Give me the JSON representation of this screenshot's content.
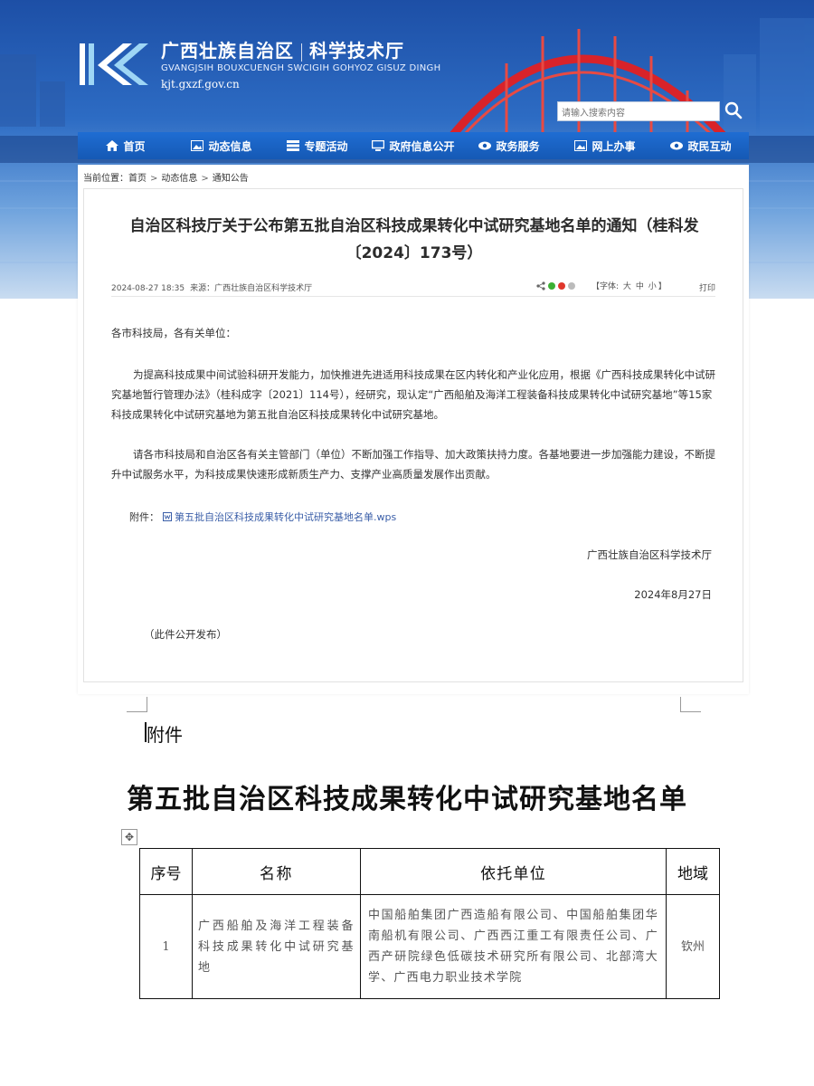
{
  "site": {
    "name_cn_left": "广西壮族自治区",
    "name_cn_right": "科学技术厅",
    "name_pinyin": "GVANGJSIH BOUXCUENGH SWCIGIH GOHYOZ GISUZ DINGH",
    "url": "kjt.gxzf.gov.cn"
  },
  "search": {
    "placeholder": "请输入搜索内容"
  },
  "nav": [
    "首页",
    "动态信息",
    "专题活动",
    "政府信息公开",
    "政务服务",
    "网上办事",
    "政民互动"
  ],
  "breadcrumb": {
    "prefix": "当前位置：",
    "items": [
      "首页",
      "动态信息",
      "通知公告"
    ]
  },
  "article": {
    "title": "自治区科技厅关于公布第五批自治区科技成果转化中试研究基地名单的通知（桂科发〔2024〕173号）",
    "datetime": "2024-08-27 18:35",
    "source": "来源：广西壮族自治区科学技术厅",
    "font_label": "【字体:",
    "font_sizes": [
      "大",
      "中",
      "小"
    ],
    "font_label_end": "】",
    "print": "打印",
    "salutation": "各市科技局，各有关单位：",
    "para1": "为提高科技成果中间试验科研开发能力，加快推进先进适用科技成果在区内转化和产业化应用，根据《广西科技成果转化中试研究基地暂行管理办法》（桂科成字〔2021〕114号），经研究，现认定“广西船舶及海洋工程装备科技成果转化中试研究基地”等15家科技成果转化中试研究基地为第五批自治区科技成果转化中试研究基地。",
    "para2": "请各市科技局和自治区各有关主管部门（单位）不断加强工作指导、加大政策扶持力度。各基地要进一步加强能力建设，不断提升中试服务水平，为科技成果快速形成新质生产力、支撑产业高质量发展作出贡献。",
    "attachment_label": "附件：",
    "attachment_file": "第五批自治区科技成果转化中试研究基地名单.wps",
    "signature": "广西壮族自治区科学技术厅",
    "date": "2024年8月27日",
    "publish_note": "（此件公开发布）"
  },
  "document": {
    "attachment_heading": "附件",
    "title": "第五批自治区科技成果转化中试研究基地名单",
    "table": {
      "headers": [
        "序号",
        "名称",
        "依托单位",
        "地域"
      ],
      "rows": [
        {
          "no": "1",
          "name": "广西船舶及海洋工程装备科技成果转化中试研究基地",
          "org": "中国船舶集团广西造船有限公司、中国船舶集团华南船机有限公司、广西西江重工有限责任公司、广西产研院绿色低碳技术研究所有限公司、北部湾大学、广西电力职业技术学院",
          "area": "钦州"
        }
      ]
    }
  },
  "colors": {
    "nav": "#1559b5",
    "title": "#2b2b2b",
    "link": "#3a5ea8",
    "bridge": "#d8232a"
  }
}
